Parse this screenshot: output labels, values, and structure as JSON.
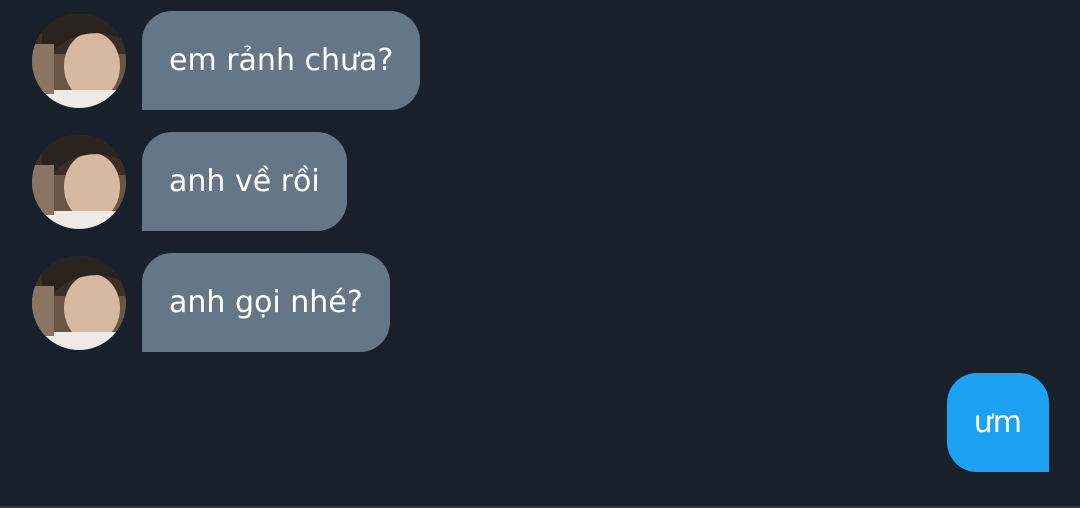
{
  "conversation": {
    "received": [
      {
        "text": "em rảnh chưa?"
      },
      {
        "text": "anh về rồi"
      },
      {
        "text": "anh gọi nhé?"
      }
    ],
    "sent": [
      {
        "text": "ưm"
      }
    ]
  },
  "colors": {
    "background": "#17202b",
    "received_bubble": "#657786",
    "sent_bubble": "#1da1f2",
    "text": "#ffffff"
  }
}
